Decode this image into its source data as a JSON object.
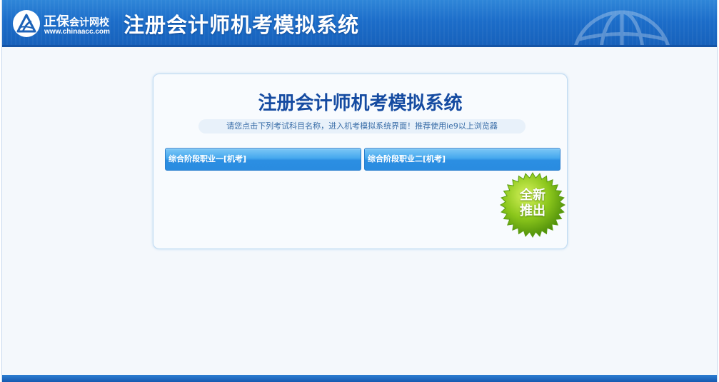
{
  "header": {
    "brand_name_big": "正保",
    "brand_name_small": "会计网校",
    "brand_url": "www.chinaacc.com",
    "system_title": "注册会计师机考模拟系统",
    "logo_icon": "chinaacc-logo-icon",
    "background_icon": "globe-icon"
  },
  "panel": {
    "title": "注册会计师机考模拟系统",
    "notice": "请您点击下列考试科目名称，进入机考模拟系统界面！推荐使用ie9以上浏览器",
    "exams": [
      {
        "label": "综合阶段职业一[机考]"
      },
      {
        "label": "综合阶段职业二[机考]"
      }
    ],
    "badge": {
      "line1": "全新",
      "line2": "推出"
    }
  },
  "colors": {
    "header_blue": "#1c6dc9",
    "title_blue": "#154ba1",
    "button_blue": "#45a8ee",
    "badge_green": "#8cc71c"
  }
}
